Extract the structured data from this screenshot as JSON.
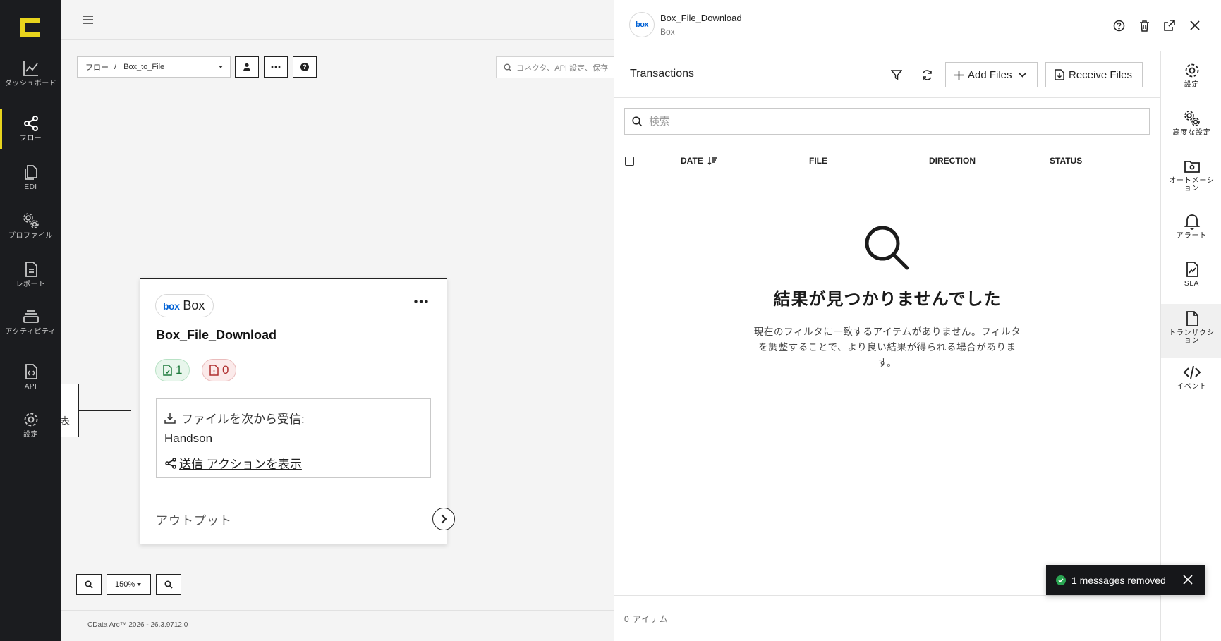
{
  "leftnav": {
    "items": [
      {
        "label": "ダッシュボード",
        "icon": "chart-line-icon"
      },
      {
        "label": "フロー",
        "icon": "share-nodes-icon",
        "active": true
      },
      {
        "label": "EDI",
        "icon": "documents-icon"
      },
      {
        "label": "プロファイル",
        "icon": "gears-icon"
      },
      {
        "label": "レポート",
        "icon": "report-icon"
      },
      {
        "label": "アクティビティ",
        "icon": "stack-icon"
      },
      {
        "label": "API",
        "icon": "api-file-icon"
      },
      {
        "label": "設定",
        "icon": "gear-icon"
      }
    ]
  },
  "canvas": {
    "breadcrumb_root": "フロー",
    "breadcrumb_sep": "/",
    "breadcrumb_flow": "Box_to_File",
    "search_placeholder": "コネクタ、API 設定、保存",
    "left_node_text": "表",
    "zoom_value": "150%",
    "version": "CData Arc™ 2026 - 26.3.9712.0"
  },
  "node": {
    "badge_logo": "box",
    "badge_label": "Box",
    "title": "Box_File_Download",
    "success_count": "1",
    "error_count": "0",
    "receive_label": "ファイルを次から受信:",
    "receive_source": "Handson",
    "send_link": "送信 アクションを表示",
    "output_label": "アウトプット"
  },
  "panel": {
    "logo": "box",
    "title": "Box_File_Download",
    "subtitle": "Box",
    "transactions_title": "Transactions",
    "add_files_label": "Add Files",
    "receive_files_label": "Receive Files",
    "search_placeholder": "検索",
    "columns": [
      "DATE",
      "FILE",
      "DIRECTION",
      "STATUS"
    ],
    "empty_title": "結果が見つかりませんでした",
    "empty_desc": "現在のフィルタに一致するアイテムがありません。フィルタを調整することで、より良い結果が得られる場合があります。",
    "item_count": "0 アイテム"
  },
  "rightnav": {
    "items": [
      {
        "label": "設定",
        "icon": "gear-icon"
      },
      {
        "label": "高度な設定",
        "icon": "gears-icon"
      },
      {
        "label": "オートメーション",
        "icon": "folder-gear-icon"
      },
      {
        "label": "アラート",
        "icon": "bell-icon"
      },
      {
        "label": "SLA",
        "icon": "sla-file-icon"
      },
      {
        "label": "トランザクション",
        "icon": "document-icon",
        "active": true
      },
      {
        "label": "イベント",
        "icon": "code-icon"
      }
    ]
  },
  "toast": {
    "message": "1 messages removed"
  },
  "colors": {
    "accent": "#e8d41d",
    "nav_bg": "#1b1c1f",
    "box_blue": "#0061d5",
    "success": "#2aa552"
  }
}
